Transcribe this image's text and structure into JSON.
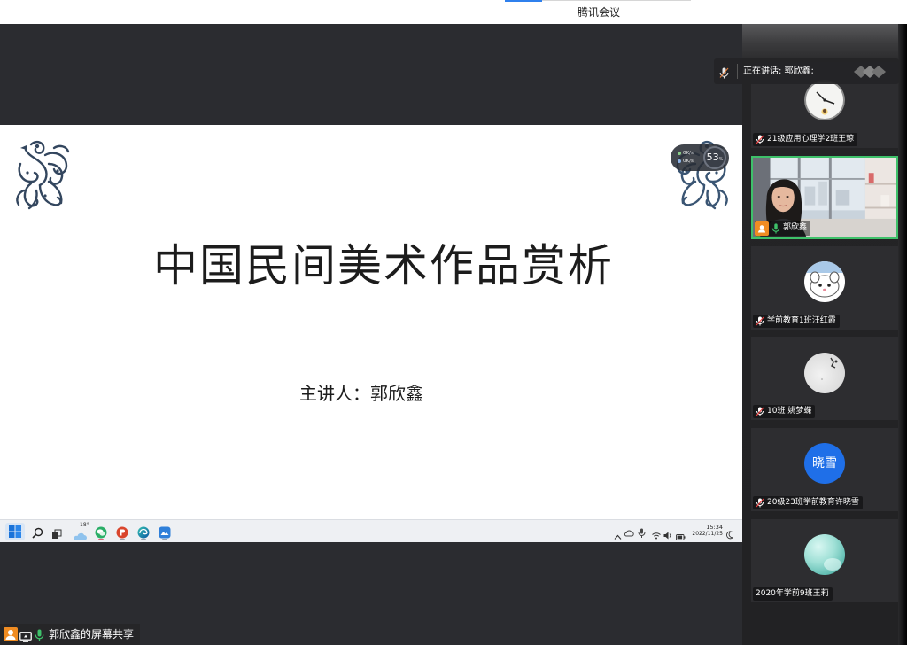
{
  "window": {
    "title": "腾讯会议"
  },
  "speaker_bar": {
    "text": "正在讲话: 郭欣鑫;",
    "icons": [
      "speaker-mic-icon",
      "speaker-bar-badge-icon"
    ]
  },
  "slide": {
    "title": "中国民间美术作品赏析",
    "presenter": "主讲人：郭欣鑫",
    "decorations": [
      "phoenix-left-image",
      "phoenix-right-image"
    ]
  },
  "network_widget": {
    "upload": "0K/s",
    "download": "0K/s",
    "value": "53",
    "unit": "%"
  },
  "taskbar": {
    "weather_temp": "18°",
    "time": "15:34",
    "date": "2022/11/25",
    "left_icons": [
      "start-icon",
      "search-icon",
      "task-view-icon",
      "weather-icon",
      "chat-app-icon",
      "powerpoint-icon",
      "edge-icon",
      "meeting-app-icon"
    ],
    "tray_icons": [
      "chevron-up-icon",
      "sync-icon",
      "mic-tray-icon",
      "wifi-icon",
      "volume-icon",
      "battery-icon",
      "notification-icon"
    ]
  },
  "participants": [
    {
      "name": "21级应用心理学2班王琼",
      "icons": [
        "mic-muted-icon"
      ],
      "avatar": "clock-avatar"
    },
    {
      "name": "郭欣鑫",
      "icons": [
        "person-badge-icon",
        "mic-on-icon"
      ],
      "avatar": "video-feed"
    },
    {
      "name": "学前教育1班汪红霞",
      "icons": [
        "mic-muted-icon"
      ],
      "avatar": "cartoon-avatar"
    },
    {
      "name": "10班 姚梦蝶",
      "icons": [
        "mic-muted-icon"
      ],
      "avatar": "photo-avatar"
    },
    {
      "name": "20级23班学前教育许晓雪",
      "icons": [
        "mic-muted-icon"
      ],
      "avatar_text": "晓雪"
    },
    {
      "name": "2020年学前9班王莉",
      "icons": [],
      "avatar": "sphere-avatar"
    }
  ],
  "screen_share": {
    "label": "郭欣鑫的屏幕共享",
    "icons": [
      "person-badge-icon",
      "screen-share-icon",
      "mic-on-icon"
    ]
  },
  "colors": {
    "speaker_border": "#3ec16a",
    "host_badge": "#f08c22",
    "avatar_blue": "#1f6fe8",
    "mic_on": "#3ec16a",
    "mic_muted_slash": "#e94040"
  }
}
